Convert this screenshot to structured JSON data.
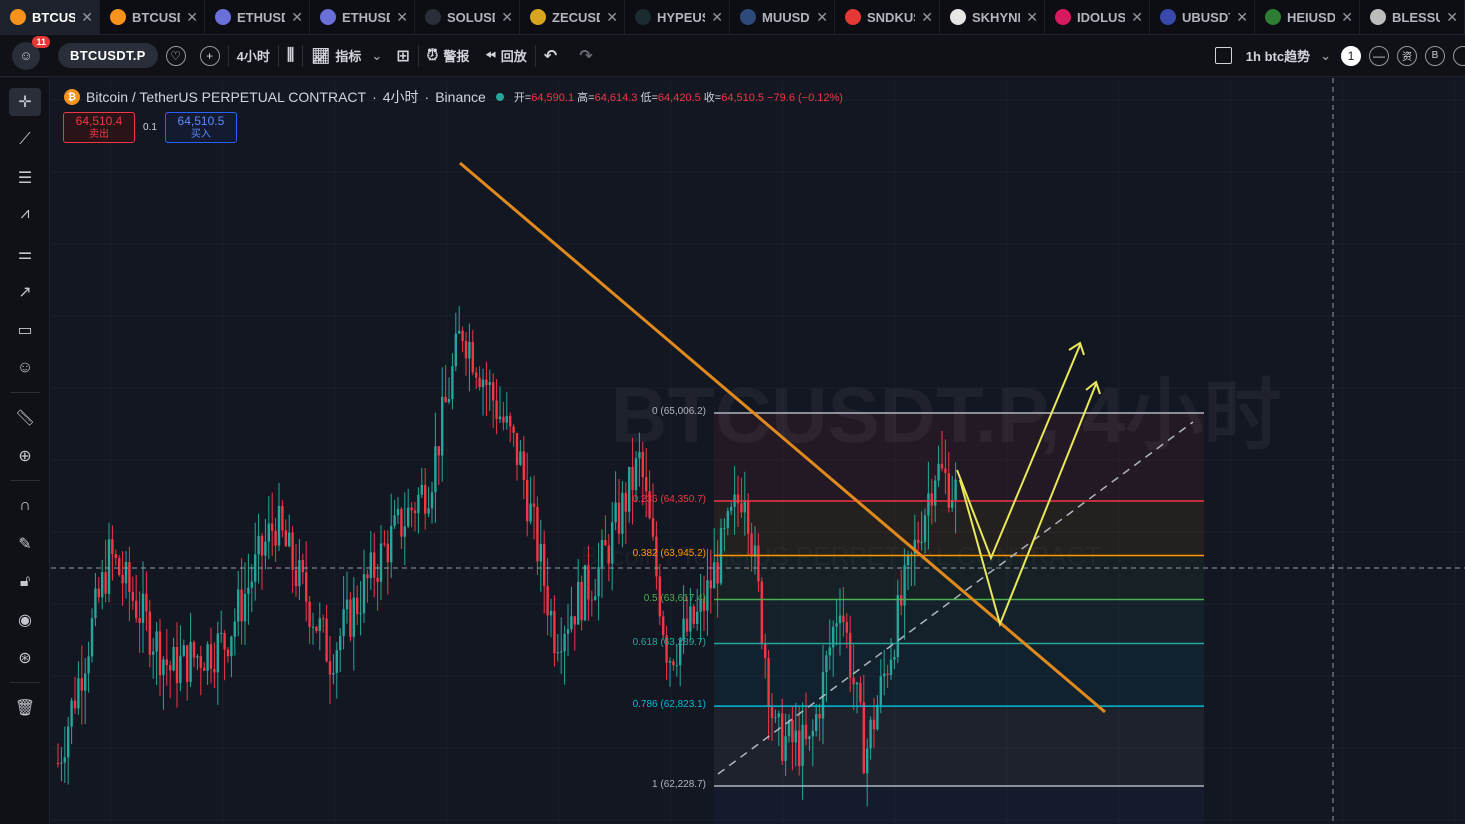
{
  "tabs": [
    {
      "label": "BTCUSDT",
      "icon": "bitcoin-icon",
      "color": "#f7931a",
      "active": true
    },
    {
      "label": "BTCUSDT",
      "icon": "bitcoin-icon",
      "color": "#f7931a",
      "active": false
    },
    {
      "label": "ETHUSDT",
      "icon": "ethereum-icon",
      "color": "#6b6fd8",
      "active": false
    },
    {
      "label": "ETHUSDT",
      "icon": "ethereum-icon",
      "color": "#6b6fd8",
      "active": false
    },
    {
      "label": "SOLUSDT",
      "icon": "solana-icon",
      "color": "#2a2e39",
      "active": false
    },
    {
      "label": "ZECUSDT",
      "icon": "zcash-icon",
      "color": "#d9a520",
      "active": false
    },
    {
      "label": "HYPEUSDT",
      "icon": "hype-icon",
      "color": "#1b2b30",
      "active": false
    },
    {
      "label": "MUUSDT",
      "icon": "mu-icon",
      "color": "#2e4a7a",
      "active": false
    },
    {
      "label": "SNDKUSDT",
      "icon": "sndk-icon",
      "color": "#e53935",
      "active": false
    },
    {
      "label": "SKHYNIX",
      "icon": "skhynix-icon",
      "color": "#e6e6e6",
      "active": false
    },
    {
      "label": "IDOLUSDT",
      "icon": "idol-icon",
      "color": "#d81b60",
      "active": false
    },
    {
      "label": "UBUSDT",
      "icon": "ub-icon",
      "color": "#3949ab",
      "active": false
    },
    {
      "label": "HEIUSDT",
      "icon": "hei-icon",
      "color": "#2e7d32",
      "active": false
    },
    {
      "label": "BLESSUSDT",
      "icon": "bless-icon",
      "color": "#bdbdbd",
      "active": false
    }
  ],
  "toolbar": {
    "notifications": "11",
    "symbol": "BTCUSDT.P",
    "interval": "4小时",
    "indicators": "指标",
    "alerts": "警报",
    "replay": "回放",
    "layout_name": "1h btc趋势",
    "right_buttons": [
      "1",
      "—",
      "资",
      "B"
    ]
  },
  "legend": {
    "pair": "Bitcoin / TetherUS PERPETUAL CONTRACT",
    "interval": "4小时",
    "exchange": "Binance",
    "open_label": "开=",
    "open": "64,590.1",
    "high_label": "高=",
    "high": "64,614.3",
    "low_label": "低=",
    "low": "64,420.5",
    "close_label": "收=",
    "close": "64,510.5",
    "change": "−79.6 (−0.12%)"
  },
  "trade": {
    "sell_price": "64,510.4",
    "sell_label": "卖出",
    "spread": "0.1",
    "buy_price": "64,510.5",
    "buy_label": "买入"
  },
  "watermark": {
    "main": "BTCUSDT.P, 4小时",
    "sub": "Bitcoin / TetherUS PERPETUAL CONTRACT"
  },
  "fib_levels": [
    {
      "ratio": "0",
      "price": "65,006.2",
      "value": 65006.2,
      "color": "#b2b5be"
    },
    {
      "ratio": "0.236",
      "price": "64,350.7",
      "value": 64350.7,
      "color": "#f23645"
    },
    {
      "ratio": "0.382",
      "price": "63,945.2",
      "value": 63945.2,
      "color": "#ff9800"
    },
    {
      "ratio": "0.5",
      "price": "63,617.4",
      "value": 63617.4,
      "color": "#4caf50"
    },
    {
      "ratio": "0.618",
      "price": "63,289.7",
      "value": 63289.7,
      "color": "#26a69a"
    },
    {
      "ratio": "0.786",
      "price": "62,823.1",
      "value": 62823.1,
      "color": "#00bcd4"
    },
    {
      "ratio": "1",
      "price": "62,228.7",
      "value": 62228.7,
      "color": "#b2b5be"
    }
  ],
  "colors": {
    "up": "#26a69a",
    "down": "#f23645",
    "trendline": "#e08a1e",
    "projection": "#e8e85a",
    "background": "#131722"
  }
}
